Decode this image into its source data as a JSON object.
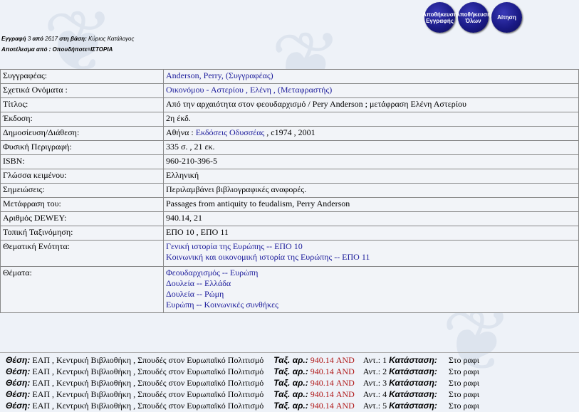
{
  "buttons": {
    "save_record": "Αποθήκευση Εγγραφής",
    "save_all": "Αποθήκευση Όλων",
    "request": "Αίτηση"
  },
  "record_info": {
    "record_label": "Εγγραφή",
    "record_num": "3",
    "from_label": "από",
    "total": "2617",
    "db_label": "στη βάση:",
    "db_name": "Κύριος Κατάλογος",
    "result_label": "Αποτέλεσμα από : Οπουδήποτε=ΙΣΤΟΡΙΑ"
  },
  "fields": {
    "author": {
      "label": "Συγγραφέας:",
      "value": "Anderson, Perry, (Συγγραφέας)"
    },
    "related": {
      "label": "Σχετικά Ονόματα :",
      "value": "Οικονόμου - Αστερίου , Ελένη , (Μεταφραστής)"
    },
    "title": {
      "label": "Τίτλος:",
      "value": "Από την αρχαιότητα στον φεουδαρχισμό / Pery Anderson ; μετάφραση Ελένη Αστερίου"
    },
    "edition": {
      "label": "Έκδοση:",
      "value": "2η έκδ."
    },
    "publication": {
      "label": "Δημοσίευση/Διάθεση:",
      "prefix": "Αθήνα : ",
      "link": "Εκδόσεις Οδυσσέας",
      "suffix": " , c1974 , 2001"
    },
    "physical": {
      "label": "Φυσική Περιγραφή:",
      "value": "335 σ. , 21 εκ."
    },
    "isbn": {
      "label": "ISBN:",
      "value": "960-210-396-5"
    },
    "language": {
      "label": "Γλώσσα κειμένου:",
      "value": "Ελληνική"
    },
    "notes": {
      "label": "Σημειώσεις:",
      "value": "Περιλαμβάνει βιβλιογραφικές αναφορές."
    },
    "translation_of": {
      "label": "Μετάφραση του:",
      "value": "Passages from antiquity to feudalism, Perry Anderson"
    },
    "dewey": {
      "label": "Αριθμός DEWEY:",
      "value": "940.14, 21"
    },
    "local_class": {
      "label": "Τοπική Ταξινόμηση:",
      "value": "ΕΠΟ 10 , ΕΠΟ 11"
    },
    "thematic_unit": {
      "label": "Θεματική Ενότητα:",
      "values": [
        "Γενική ιστορία της Ευρώπης -- ΕΠΟ 10",
        "Κοινωνική και οικονομική ιστορία της Ευρώπης -- ΕΠΟ 11"
      ]
    },
    "subjects": {
      "label": "Θέματα:",
      "values": [
        "Φεουδαρχισμός -- Ευρώπη",
        "Δουλεία -- Ελλάδα",
        "Δουλεία -- Ρώμη",
        "Ευρώπη -- Κοινωνικές συνθήκες"
      ]
    }
  },
  "holdings": {
    "location_label": "Θέση:",
    "location": "ΕΑΠ , Κεντρική Βιβλιοθήκη , Σπουδές στον Ευρωπαϊκό Πολιτισμό",
    "call_label": "Ταξ. αρ.:",
    "call_number": "940.14 AND",
    "status_label": "Κατάσταση:",
    "copies": [
      {
        "copy": "Αντ.: 1",
        "status": "Στο ραφι"
      },
      {
        "copy": "Αντ.: 2",
        "status": "Στο ραφι"
      },
      {
        "copy": "Αντ.: 3",
        "status": "Στο ραφι"
      },
      {
        "copy": "Αντ.: 4",
        "status": "Στο ραφι"
      },
      {
        "copy": "Αντ.: 5",
        "status": "Στο ραφι"
      }
    ]
  }
}
